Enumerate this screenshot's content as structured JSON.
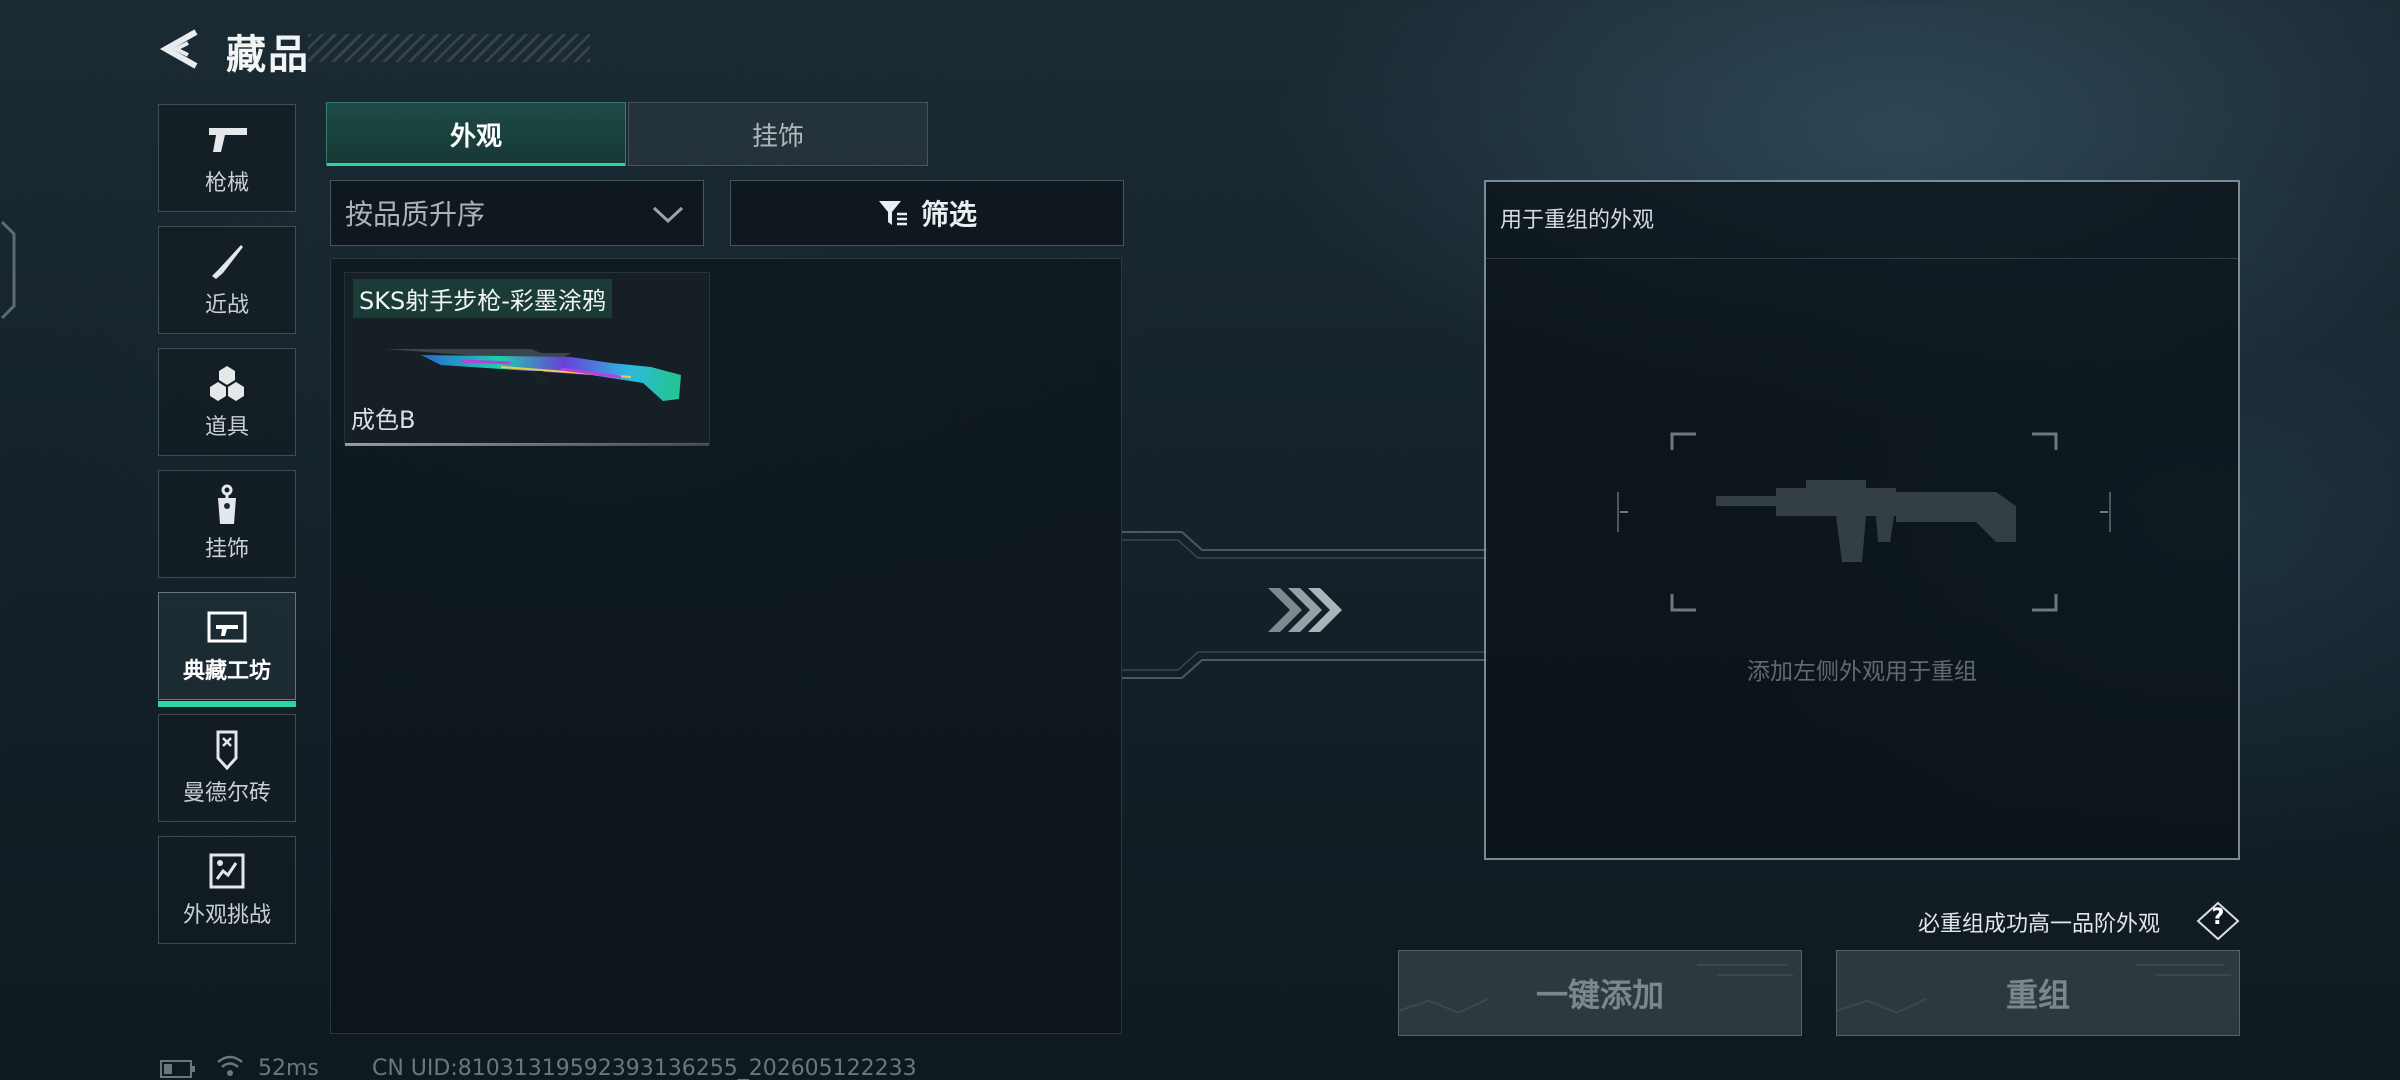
{
  "header": {
    "title": "藏品"
  },
  "sidebar": {
    "items": [
      {
        "label": "枪械",
        "icon": "gun-icon"
      },
      {
        "label": "近战",
        "icon": "knife-icon"
      },
      {
        "label": "道具",
        "icon": "items-icon"
      },
      {
        "label": "挂饰",
        "icon": "charm-icon"
      },
      {
        "label": "典藏工坊",
        "icon": "workshop-icon",
        "active": true
      },
      {
        "label": "曼德尔砖",
        "icon": "mandel-brick-icon"
      },
      {
        "label": "外观挑战",
        "icon": "challenge-icon"
      }
    ]
  },
  "tabs": [
    {
      "label": "外观",
      "active": true
    },
    {
      "label": "挂饰",
      "active": false
    }
  ],
  "toolbar": {
    "sort_label": "按品质升序",
    "filter_label": "筛选"
  },
  "items": [
    {
      "name": "SKS射手步枪-彩墨涂鸦",
      "grade": "成色B"
    }
  ],
  "recompose": {
    "panel_title": "用于重组的外观",
    "hint": "添加左侧外观用于重组",
    "rule_text": "必重组成功高一品阶外观",
    "help_label": "?",
    "add_all_label": "一键添加",
    "recompose_label": "重组"
  },
  "status": {
    "ping": "52ms",
    "uid": "CN UID:81031319592393136255_202605122233"
  },
  "colors": {
    "accent": "#2dd4a0",
    "panel_border": "#c8d7de"
  }
}
